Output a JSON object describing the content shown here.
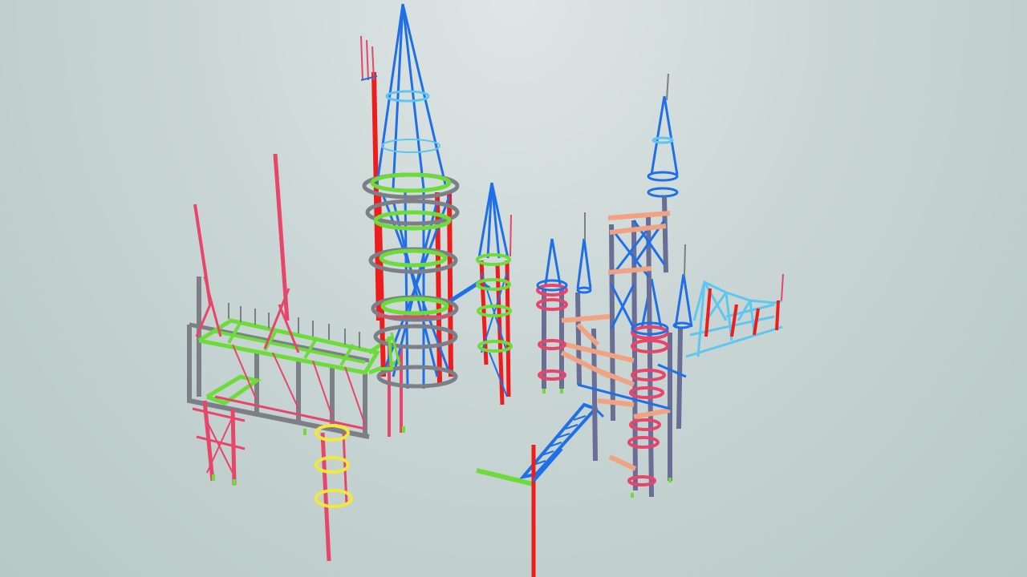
{
  "viewer": {
    "status": "",
    "background_top": "#dfe6e5",
    "background_bottom": "#b7c8c6"
  },
  "palette": {
    "column_red": "#ee1c1c",
    "member_pink": "#e8456a",
    "brace_blue": "#1f6fe8",
    "light_blue": "#5fc6ee",
    "beam_green": "#6ddc3a",
    "frame_gray": "#7c7f86",
    "beam_salmon": "#f0a282",
    "ring_yellow": "#f2e83a",
    "column_slate": "#6a6d94"
  },
  "model": {
    "structures": [
      {
        "id": "pink-frame-block",
        "kind": "frame"
      },
      {
        "id": "tall-circular-tower",
        "kind": "lattice-tower"
      },
      {
        "id": "small-spire-tower",
        "kind": "lattice-tower"
      },
      {
        "id": "right-column-cluster",
        "kind": "frame"
      },
      {
        "id": "right-truss-wing",
        "kind": "truss"
      },
      {
        "id": "stair-bridge",
        "kind": "bridge"
      },
      {
        "id": "yellow-ring-stack",
        "kind": "column"
      },
      {
        "id": "axis-gizmo",
        "kind": "gizmo"
      }
    ]
  }
}
